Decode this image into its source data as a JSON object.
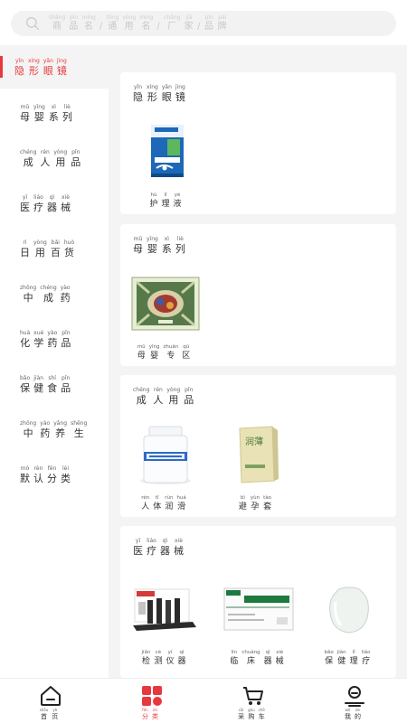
{
  "search": {
    "placeholder": [
      {
        "zh": "商",
        "py": "shāng"
      },
      {
        "zh": "品",
        "py": "pǐn"
      },
      {
        "zh": "名",
        "py": "míng"
      },
      {
        "zh": "/",
        "py": ""
      },
      {
        "zh": "通",
        "py": "tōng"
      },
      {
        "zh": "用",
        "py": "yòng"
      },
      {
        "zh": "名",
        "py": "míng"
      },
      {
        "zh": "/",
        "py": ""
      },
      {
        "zh": "厂",
        "py": "chǎng"
      },
      {
        "zh": "家",
        "py": "jiā"
      },
      {
        "zh": "/",
        "py": ""
      },
      {
        "zh": "品",
        "py": "pǐn"
      },
      {
        "zh": "牌",
        "py": "pái"
      }
    ]
  },
  "sidebar": {
    "items": [
      {
        "chars": [
          {
            "zh": "隐",
            "py": "yǐn"
          },
          {
            "zh": "形",
            "py": "xíng"
          },
          {
            "zh": "眼",
            "py": "yǎn"
          },
          {
            "zh": "镜",
            "py": "jìng"
          }
        ],
        "active": true
      },
      {
        "chars": [
          {
            "zh": "母",
            "py": "mǔ"
          },
          {
            "zh": "婴",
            "py": "yīng"
          },
          {
            "zh": "系",
            "py": "xì"
          },
          {
            "zh": "列",
            "py": "liè"
          }
        ]
      },
      {
        "chars": [
          {
            "zh": "成",
            "py": "chéng"
          },
          {
            "zh": "人",
            "py": "rén"
          },
          {
            "zh": "用",
            "py": "yòng"
          },
          {
            "zh": "品",
            "py": "pǐn"
          }
        ]
      },
      {
        "chars": [
          {
            "zh": "医",
            "py": "yī"
          },
          {
            "zh": "疗",
            "py": "liáo"
          },
          {
            "zh": "器",
            "py": "qì"
          },
          {
            "zh": "械",
            "py": "xiè"
          }
        ]
      },
      {
        "chars": [
          {
            "zh": "日",
            "py": "rì"
          },
          {
            "zh": "用",
            "py": "yòng"
          },
          {
            "zh": "百",
            "py": "bǎi"
          },
          {
            "zh": "货",
            "py": "huò"
          }
        ]
      },
      {
        "chars": [
          {
            "zh": "中",
            "py": "zhōng"
          },
          {
            "zh": "成",
            "py": "chéng"
          },
          {
            "zh": "药",
            "py": "yào"
          }
        ]
      },
      {
        "chars": [
          {
            "zh": "化",
            "py": "huà"
          },
          {
            "zh": "学",
            "py": "xué"
          },
          {
            "zh": "药",
            "py": "yào"
          },
          {
            "zh": "品",
            "py": "pǐn"
          }
        ]
      },
      {
        "chars": [
          {
            "zh": "保",
            "py": "bǎo"
          },
          {
            "zh": "健",
            "py": "jiàn"
          },
          {
            "zh": "食",
            "py": "shí"
          },
          {
            "zh": "品",
            "py": "pǐn"
          }
        ]
      },
      {
        "chars": [
          {
            "zh": "中",
            "py": "zhōng"
          },
          {
            "zh": "药",
            "py": "yào"
          },
          {
            "zh": "养",
            "py": "yǎng"
          },
          {
            "zh": "生",
            "py": "shēng"
          }
        ]
      },
      {
        "chars": [
          {
            "zh": "默",
            "py": "mò"
          },
          {
            "zh": "认",
            "py": "rèn"
          },
          {
            "zh": "分",
            "py": "fēn"
          },
          {
            "zh": "类",
            "py": "lèi"
          }
        ]
      }
    ]
  },
  "sections": [
    {
      "title": [
        {
          "zh": "隐",
          "py": "yǐn"
        },
        {
          "zh": "形",
          "py": "xíng"
        },
        {
          "zh": "眼",
          "py": "yǎn"
        },
        {
          "zh": "镜",
          "py": "jìng"
        }
      ],
      "products": [
        {
          "name": [
            {
              "zh": "护",
              "py": "hù"
            },
            {
              "zh": "理",
              "py": "lǐ"
            },
            {
              "zh": "液",
              "py": "yè"
            }
          ],
          "image": "contact-lens-solution-box"
        }
      ]
    },
    {
      "title": [
        {
          "zh": "母",
          "py": "mǔ"
        },
        {
          "zh": "婴",
          "py": "yīng"
        },
        {
          "zh": "系",
          "py": "xì"
        },
        {
          "zh": "列",
          "py": "liè"
        }
      ],
      "products": [
        {
          "name": [
            {
              "zh": "母",
              "py": "mǔ"
            },
            {
              "zh": "婴",
              "py": "yīng"
            },
            {
              "zh": "专",
              "py": "zhuān"
            },
            {
              "zh": "区",
              "py": "qū"
            }
          ],
          "image": "baby-product-box"
        }
      ]
    },
    {
      "title": [
        {
          "zh": "成",
          "py": "chéng"
        },
        {
          "zh": "人",
          "py": "rén"
        },
        {
          "zh": "用",
          "py": "yòng"
        },
        {
          "zh": "品",
          "py": "pǐn"
        }
      ],
      "products": [
        {
          "name": [
            {
              "zh": "人",
              "py": "rén"
            },
            {
              "zh": "体",
              "py": "tǐ"
            },
            {
              "zh": "润",
              "py": "rùn"
            },
            {
              "zh": "滑",
              "py": "huá"
            }
          ],
          "image": "lubricant-bottle"
        },
        {
          "name": [
            {
              "zh": "避",
              "py": "bì"
            },
            {
              "zh": "孕",
              "py": "yùn"
            },
            {
              "zh": "套",
              "py": "tào"
            }
          ],
          "image": "condom-box",
          "box_text": "润薄"
        }
      ]
    },
    {
      "title": [
        {
          "zh": "医",
          "py": "yī"
        },
        {
          "zh": "疗",
          "py": "liáo"
        },
        {
          "zh": "器",
          "py": "qì"
        },
        {
          "zh": "械",
          "py": "xiè"
        }
      ],
      "products": [
        {
          "name": [
            {
              "zh": "检",
              "py": "jiǎn"
            },
            {
              "zh": "测",
              "py": "cè"
            },
            {
              "zh": "仪",
              "py": "yí"
            },
            {
              "zh": "器",
              "py": "qì"
            }
          ],
          "image": "test-strips-kit"
        },
        {
          "name": [
            {
              "zh": "临",
              "py": "lín"
            },
            {
              "zh": "床",
              "py": "chuáng"
            },
            {
              "zh": "器",
              "py": "qì"
            },
            {
              "zh": "械",
              "py": "xiè"
            }
          ],
          "image": "clinical-device-box"
        },
        {
          "name": [
            {
              "zh": "保",
              "py": "bǎo"
            },
            {
              "zh": "健",
              "py": "jiàn"
            },
            {
              "zh": "理",
              "py": "lǐ"
            },
            {
              "zh": "疗",
              "py": "liáo"
            }
          ],
          "image": "glass-cupping-jar"
        }
      ]
    }
  ],
  "tabbar": {
    "tabs": [
      {
        "icon": "home-icon",
        "label": [
          {
            "zh": "首",
            "py": "shǒu"
          },
          {
            "zh": "页",
            "py": "yè"
          }
        ]
      },
      {
        "icon": "category-icon",
        "label": [
          {
            "zh": "分",
            "py": "fēn"
          },
          {
            "zh": "类",
            "py": "lèi"
          }
        ],
        "active": true
      },
      {
        "icon": "cart-icon",
        "label": [
          {
            "zh": "采",
            "py": "cǎi"
          },
          {
            "zh": "购",
            "py": "gòu"
          },
          {
            "zh": "车",
            "py": "chē"
          }
        ]
      },
      {
        "icon": "user-icon",
        "label": [
          {
            "zh": "我",
            "py": "wǒ"
          },
          {
            "zh": "的",
            "py": "de"
          }
        ]
      }
    ]
  },
  "colors": {
    "accent": "#e8383d",
    "background": "#f4f4f4"
  }
}
